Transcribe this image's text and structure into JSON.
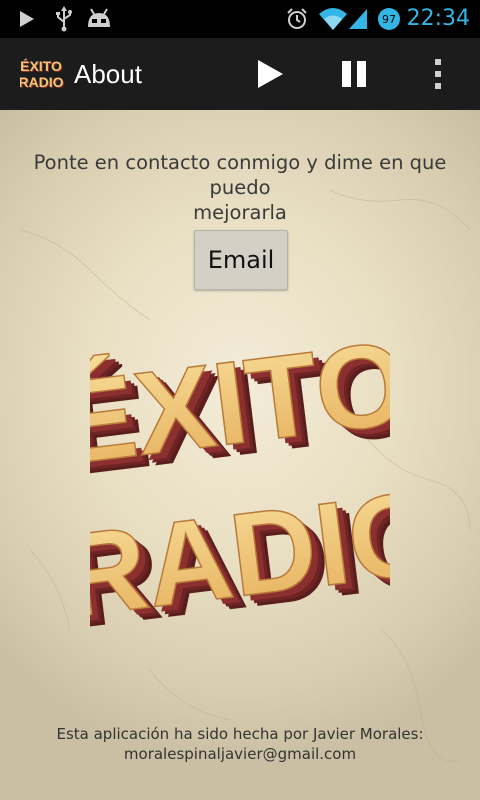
{
  "status_bar": {
    "time": "22:34",
    "battery_level": "97",
    "icons": [
      "play-icon",
      "usb-icon",
      "android-icon",
      "alarm-icon",
      "wifi-icon",
      "signal-icon",
      "battery-icon"
    ]
  },
  "action_bar": {
    "title": "About",
    "logo_text": [
      "ÉXITO",
      "RADIO"
    ],
    "buttons": [
      "play-icon",
      "pause-icon",
      "overflow-menu-icon"
    ]
  },
  "content": {
    "contact_line1": "Ponte en contacto conmigo y dime en que puedo",
    "contact_line2": "mejorarla",
    "email_button": "Email",
    "logo_line1": "ÉXITO",
    "logo_line2": "RADIO",
    "footer_line1": "Esta aplicación ha sido hecha por Javier Morales:",
    "footer_line2": "moralespinaljavier@gmail.com"
  },
  "colors": {
    "status_time": "#33b5e5",
    "action_bar": "#1c1c1c",
    "logo_fill": "#f0c873",
    "logo_side": "#8b2f2f"
  }
}
